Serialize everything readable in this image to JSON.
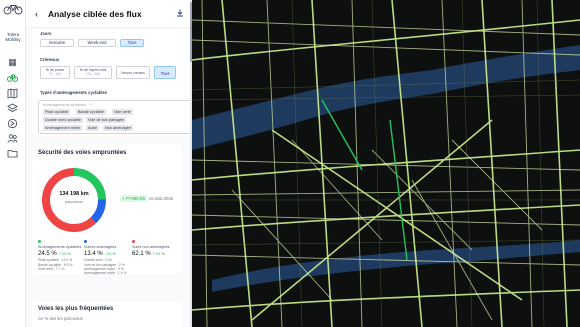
{
  "header": {
    "title": "Analyse ciblée des flux",
    "back_icon": "arrow-left-icon",
    "download_icon": "download-icon"
  },
  "sidebar": {
    "brand": "Tolera Mobility",
    "items": [
      {
        "icon": "grid-icon"
      },
      {
        "icon": "bike-icon"
      },
      {
        "icon": "map-icon"
      },
      {
        "icon": "layers-icon"
      },
      {
        "icon": "route-icon"
      },
      {
        "icon": "users-icon"
      },
      {
        "icon": "folder-icon"
      }
    ]
  },
  "jours": {
    "label": "Jours",
    "options": [
      "Semaine",
      "Week-end",
      "Tous"
    ],
    "selected": "Tous"
  },
  "creneaux": {
    "label": "Créneaux",
    "options": [
      {
        "title": "Hr de pointe",
        "sub": "7h - 10h"
      },
      {
        "title": "Hr de l'après-midi",
        "sub": "10h - 16h"
      },
      {
        "title": "Heures creuses",
        "sub": ""
      },
      {
        "title": "Tous",
        "sub": ""
      }
    ],
    "selected": "Tous"
  },
  "types": {
    "label": "Types d'aménagements cyclables",
    "placeholder": "Aménagements cyclables",
    "tags": [
      "Piste cyclable",
      "Bande cyclable",
      "Voie verte",
      "Double sens cyclable",
      "Voie de bus partagée",
      "Aménagement mixte",
      "Autre",
      "Non aménagée"
    ]
  },
  "securite": {
    "title": "Sécurité des voies empruntées",
    "total": "134 198 km",
    "total_unit": "parcourus",
    "trend": "+ 77 000 km",
    "compare": "vs août 2025",
    "donut": [
      {
        "name": "Aménagements cyclables",
        "value": 24.5,
        "color": "#22c55e"
      },
      {
        "name": "Voiries aménagées",
        "value": 13.4,
        "color": "#2563eb"
      },
      {
        "name": "Voies non aménagées",
        "value": 62.1,
        "color": "#ef4444"
      }
    ],
    "columns": [
      {
        "color": "#22c55e",
        "title": "Aménagements cyclables",
        "value": "24.5 %",
        "delta": "+ 0,2 %",
        "details": [
          "Piste cyclable : 12.9 %",
          "Bande cyclable : 6.9 %",
          "Voie verte : 7.7 %"
        ]
      },
      {
        "color": "#2563eb",
        "title": "Voiries aménagées",
        "value": "13.4 %",
        "delta": "- 0,1 %",
        "details": [
          "Double sens : 3 %",
          "Voie de bus partagée : 2 %",
          "Aménagement mixte : 5 %",
          "Aménagement mixte : 1.5 %"
        ]
      },
      {
        "color": "#ef4444",
        "title": "Voies non aménagées",
        "value": "62.1 %",
        "delta": "+ 0,1 %",
        "details": []
      }
    ]
  },
  "frequentes": {
    "title": "Voies les plus fréquentées",
    "subtitle": "Ce % des km parcourus"
  }
}
